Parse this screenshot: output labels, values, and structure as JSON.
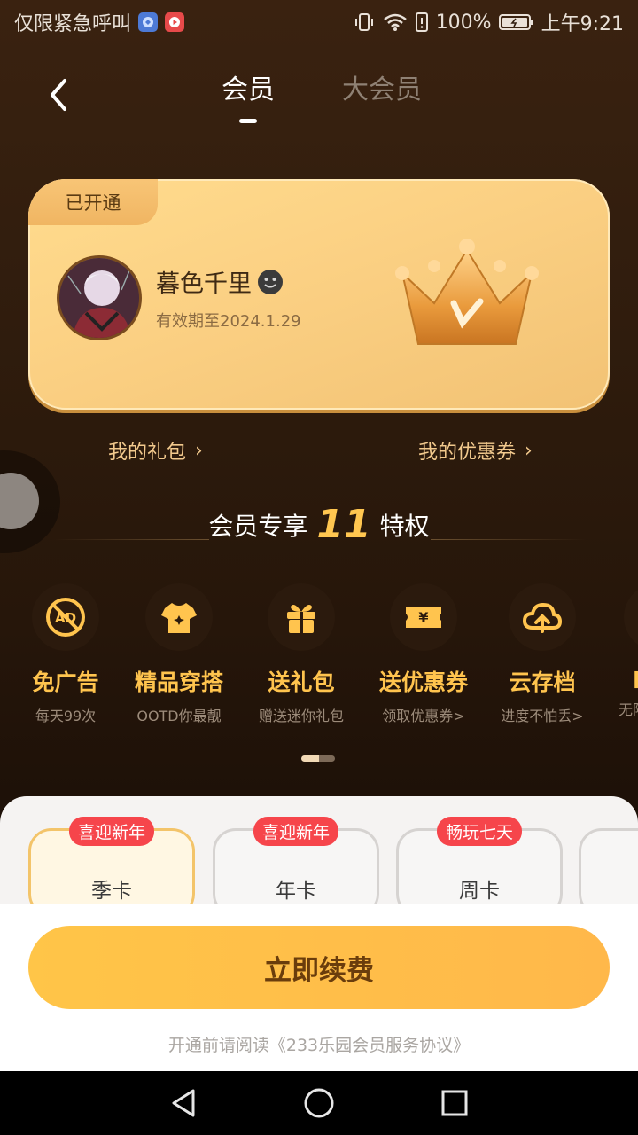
{
  "status_bar": {
    "carrier_text": "仅限紧急呼叫",
    "battery": "100%",
    "time": "上午9:21"
  },
  "header": {
    "tabs": [
      {
        "label": "会员",
        "active": true
      },
      {
        "label": "大会员",
        "active": false
      }
    ]
  },
  "member_card": {
    "badge": "已开通",
    "user_name": "暮色千里",
    "validity": "有效期至2024.1.29"
  },
  "links": {
    "gift": "我的礼包",
    "coupon": "我的优惠券"
  },
  "privileges": {
    "heading_prefix": "会员专享",
    "count": "11",
    "heading_suffix": "特权",
    "items": [
      {
        "title": "免广告",
        "sub": "每天99次",
        "icon": "no-ad-icon"
      },
      {
        "title": "精品穿搭",
        "sub": "OOTD你最靓",
        "icon": "tshirt-icon"
      },
      {
        "title": "送礼包",
        "sub": "赠送迷你礼包",
        "icon": "gift-icon"
      },
      {
        "title": "送优惠券",
        "sub": "领取优惠券>",
        "icon": "coupon-icon"
      },
      {
        "title": "云存档",
        "sub": "进度不怕丢>",
        "icon": "cloud-upload-icon"
      },
      {
        "title": "",
        "sub": "无限",
        "icon": "partial-icon"
      }
    ]
  },
  "plans": [
    {
      "label": "季卡",
      "tag": "喜迎新年",
      "selected": true
    },
    {
      "label": "年卡",
      "tag": "喜迎新年",
      "selected": false
    },
    {
      "label": "周卡",
      "tag": "畅玩七天",
      "selected": false
    }
  ],
  "renew_button": "立即续费",
  "agreement": "开通前请阅读《233乐园会员服务协议》",
  "colors": {
    "accent_gold": "#ffc44e",
    "button": "#ffc548",
    "tag_red": "#f6454b"
  }
}
